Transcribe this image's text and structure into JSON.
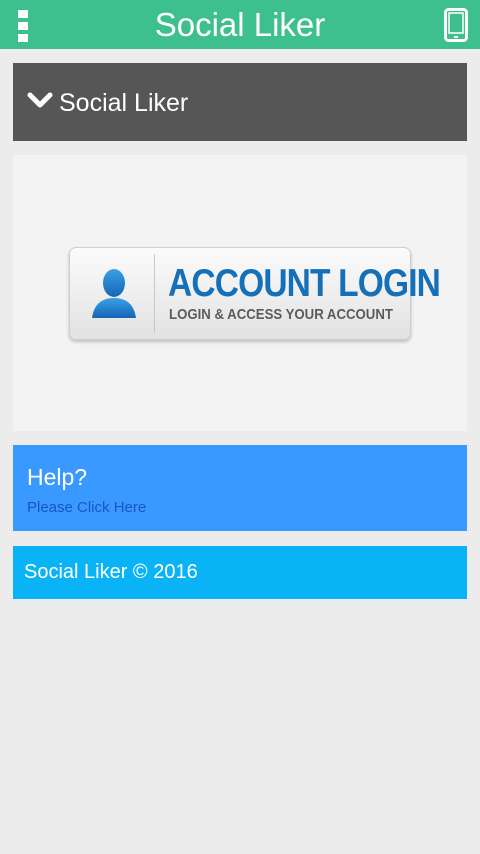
{
  "topbar": {
    "title": "Social Liker",
    "menu_icon": "overflow-menu-icon",
    "device_icon": "smartphone-icon",
    "color": "#3dbf8e"
  },
  "header": {
    "title": "Social Liker",
    "icon": "chevron-down-icon",
    "color": "#565656"
  },
  "login_banner": {
    "title": "ACCOUNT LOGIN",
    "subtitle": "LOGIN & ACCESS YOUR ACCOUNT",
    "icon": "user-icon",
    "accent": "#1670b8"
  },
  "help": {
    "title": "Help?",
    "link": "Please Click Here",
    "color": "#3a99ff"
  },
  "footer": {
    "text": "Social Liker © 2016",
    "color": "#0ab3f6"
  }
}
